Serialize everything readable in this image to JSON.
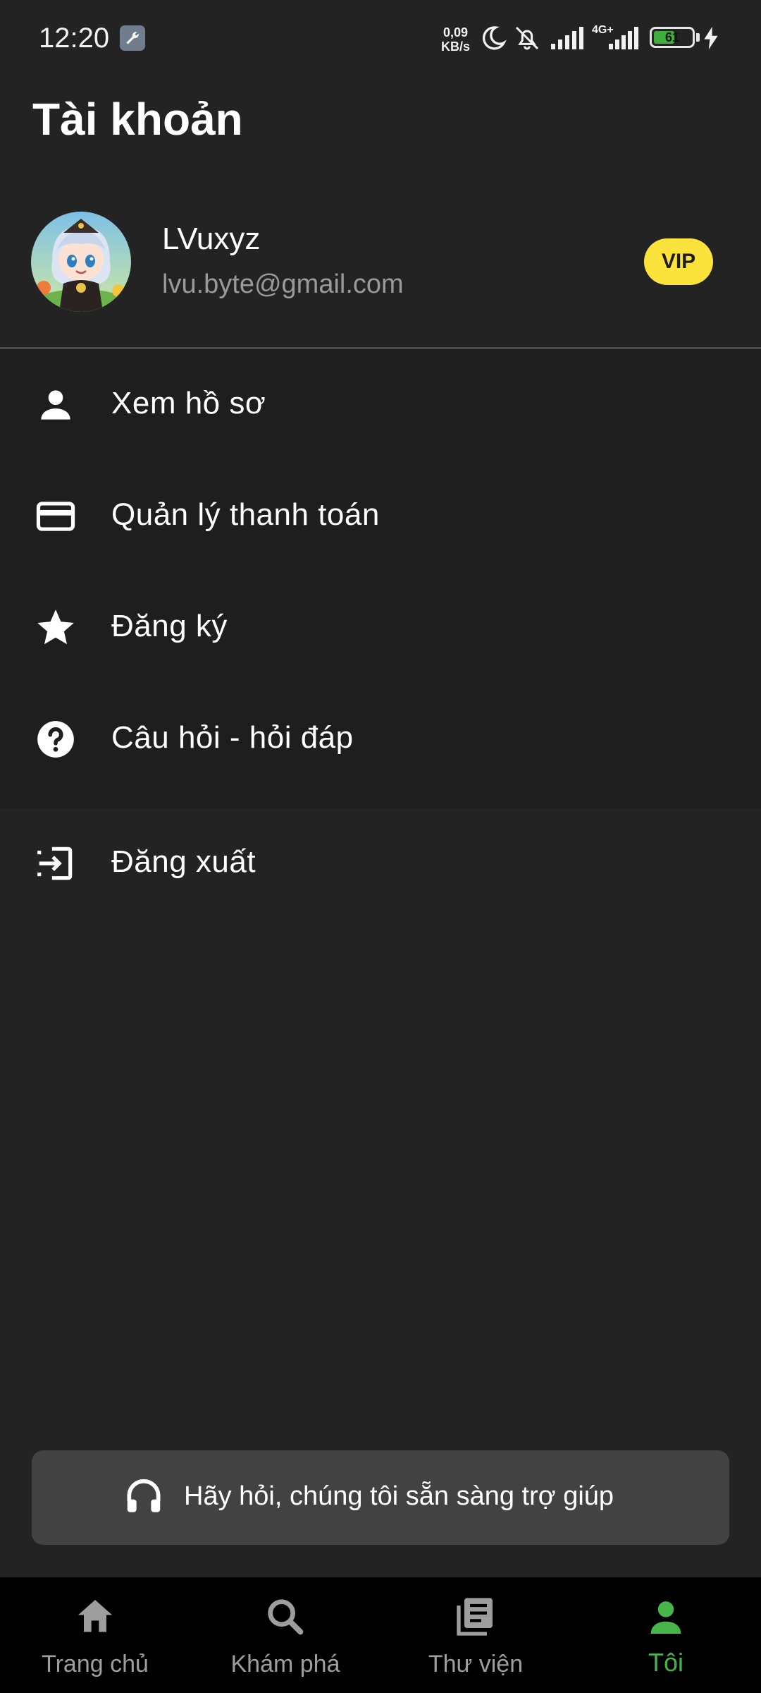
{
  "status_bar": {
    "time": "12:20",
    "net_speed_value": "0,09",
    "net_speed_unit": "KB/s",
    "network_type": "4G+",
    "battery_level": "61"
  },
  "header": {
    "title": "Tài khoản"
  },
  "profile": {
    "name": "LVuxyz",
    "email": "lvu.byte@gmail.com",
    "badge": "VIP"
  },
  "menu": {
    "items": [
      {
        "label": "Xem hồ sơ",
        "icon": "person-icon"
      },
      {
        "label": "Quản lý thanh toán",
        "icon": "credit-card-icon"
      },
      {
        "label": "Đăng ký",
        "icon": "star-icon"
      },
      {
        "label": "Câu hỏi - hỏi đáp",
        "icon": "help-circle-icon"
      },
      {
        "label": "Đăng xuất",
        "icon": "logout-icon"
      }
    ]
  },
  "help": {
    "label": "Hãy hỏi, chúng tôi sẵn sàng trợ giúp",
    "icon": "headset-icon"
  },
  "bottom_nav": {
    "items": [
      {
        "label": "Trang chủ",
        "icon": "home-icon"
      },
      {
        "label": "Khám phá",
        "icon": "search-icon"
      },
      {
        "label": "Thư viện",
        "icon": "library-icon"
      },
      {
        "label": "Tôi",
        "icon": "person-icon",
        "active": true
      }
    ]
  },
  "colors": {
    "background": "#232323",
    "accent": "#47b549",
    "vip_badge": "#fbe33c",
    "help_bar": "#424242",
    "nav_background": "#000000"
  }
}
